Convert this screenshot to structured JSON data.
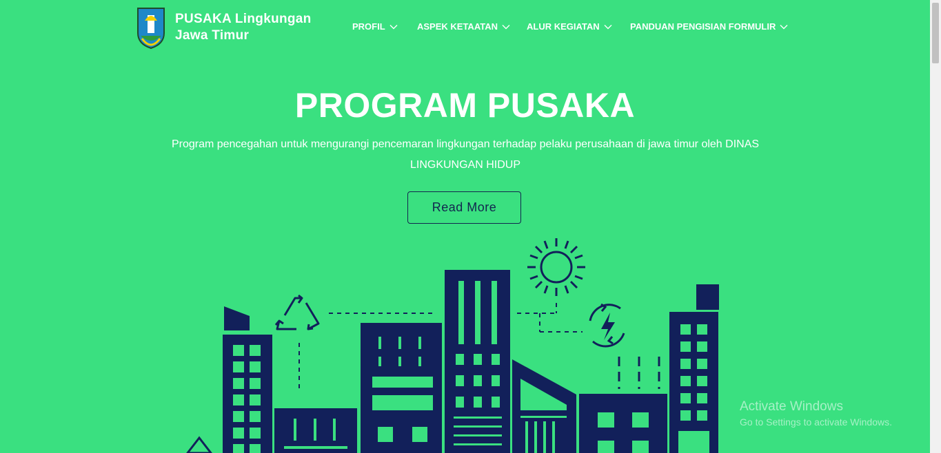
{
  "header": {
    "brand_line1": "PUSAKA Lingkungan",
    "brand_line2": "Jawa Timur",
    "nav": [
      {
        "label": "PROFIL"
      },
      {
        "label": "ASPEK KETAATAN"
      },
      {
        "label": "ALUR KEGIATAN"
      },
      {
        "label": "PANDUAN PENGISIAN FORMULIR"
      }
    ]
  },
  "hero": {
    "title": "PROGRAM PUSAKA",
    "subtitle": "Program pencegahan untuk mengurangi pencemaran lingkungan terhadap pelaku perusahaan di jawa timur oleh DINAS LINGKUNGAN HIDUP",
    "button_label": "Read More"
  },
  "watermark": {
    "line1": "Activate Windows",
    "line2": "Go to Settings to activate Windows."
  },
  "colors": {
    "background": "#3ae080",
    "illustration": "#12205a",
    "text": "#ffffff"
  },
  "icons": [
    "east-java-emblem-icon",
    "chevron-down-icon",
    "recycle-icon",
    "sun-icon",
    "energy-icon"
  ]
}
